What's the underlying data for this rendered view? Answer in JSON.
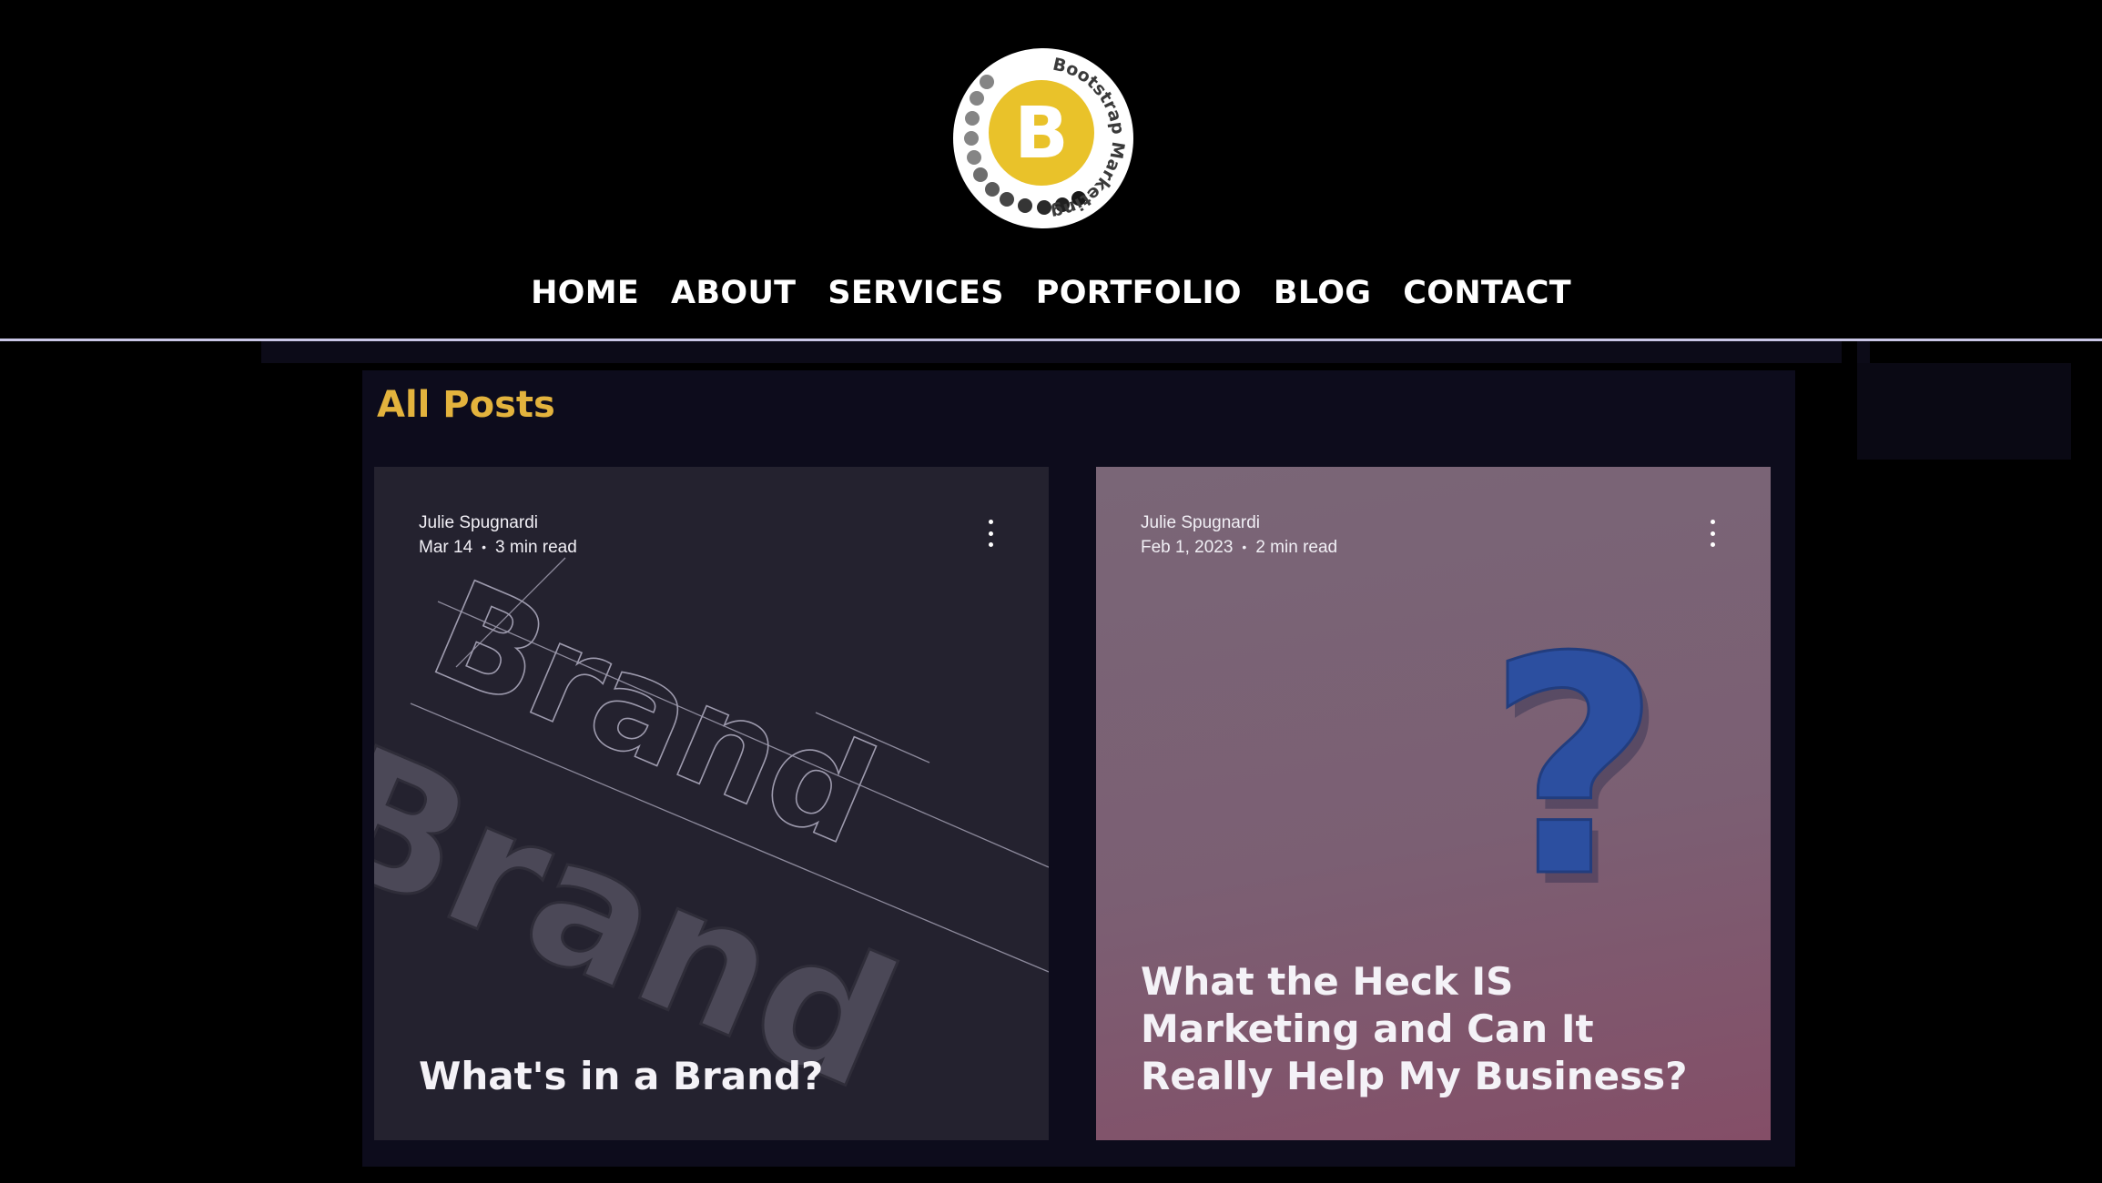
{
  "brand": {
    "ring_text": "Bootstrap Marketing",
    "letter": "B",
    "colors": {
      "yellow": "#e9c22a",
      "ring": "#ffffff",
      "dots": "#8a8a8a"
    }
  },
  "nav": {
    "items": [
      {
        "label": "HOME"
      },
      {
        "label": "ABOUT"
      },
      {
        "label": "SERVICES"
      },
      {
        "label": "PORTFOLIO"
      },
      {
        "label": "BLOG"
      },
      {
        "label": "CONTACT"
      }
    ]
  },
  "blog": {
    "section_title": "All Posts",
    "accent_color": "#e3b33d",
    "posts": [
      {
        "author": "Julie Spugnardi",
        "date": "Mar 14",
        "separator": "•",
        "read_time": "3 min read",
        "title": "What's in a Brand?",
        "art_outline_text": "Brand",
        "art_solid_text": "Brand",
        "menu_icon": "more-vertical-icon"
      },
      {
        "author": "Julie Spugnardi",
        "date": "Feb 1, 2023",
        "separator": "•",
        "read_time": "2 min read",
        "title": "What the Heck IS Marketing and Can It Really Help My Business?",
        "art_symbol": "?",
        "menu_icon": "more-vertical-icon"
      }
    ]
  }
}
